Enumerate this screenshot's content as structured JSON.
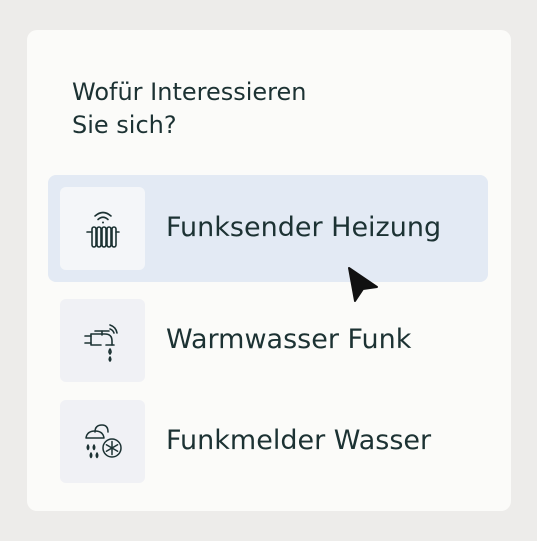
{
  "question": {
    "line1": "Wofür Interessieren",
    "line2": "Sie sich?"
  },
  "options": [
    {
      "label": "Funksender Heizung",
      "icon": "radiator-wireless-icon",
      "selected": true
    },
    {
      "label": "Warmwasser Funk",
      "icon": "water-tap-wireless-icon",
      "selected": false
    },
    {
      "label": "Funkmelder Wasser",
      "icon": "shower-snowflake-icon",
      "selected": false
    }
  ],
  "colors": {
    "background": "#edecea",
    "card": "#fbfbf9",
    "selected_option": "#e3eaf4",
    "text": "#1c3233"
  }
}
